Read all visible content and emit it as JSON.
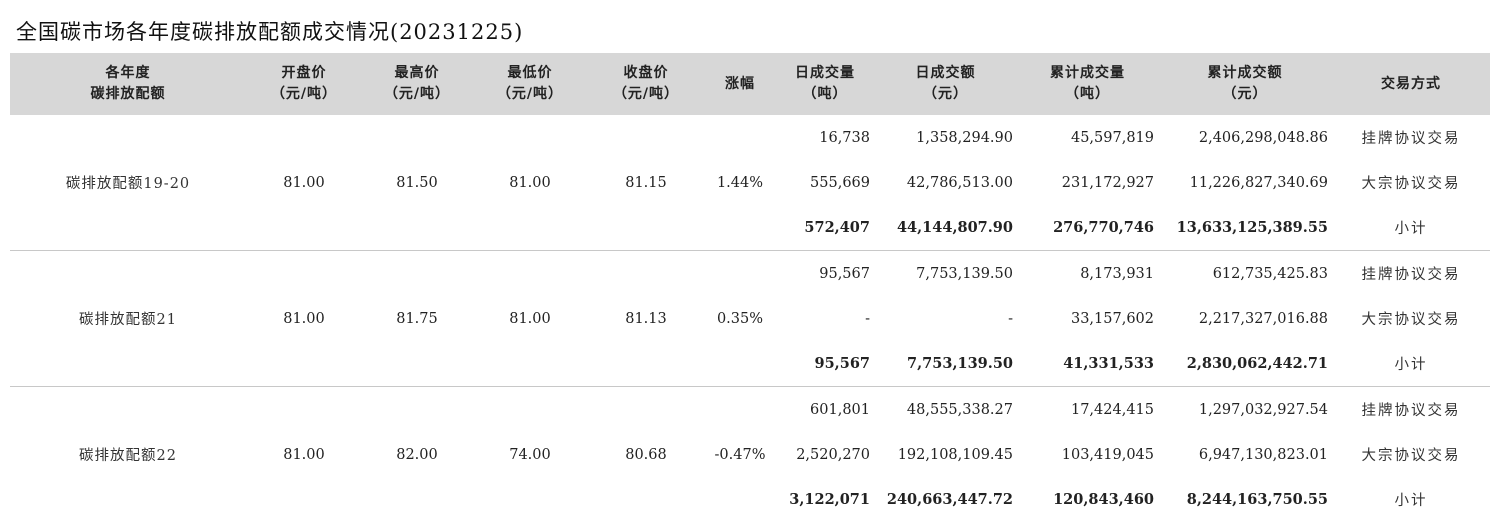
{
  "title": "全国碳市场各年度碳排放配额成交情况(20231225)",
  "table": {
    "headers": [
      {
        "line1": "各年度",
        "line2": "碳排放配额"
      },
      {
        "line1": "开盘价",
        "line2": "（元/吨）"
      },
      {
        "line1": "最高价",
        "line2": "（元/吨）"
      },
      {
        "line1": "最低价",
        "line2": "（元/吨）"
      },
      {
        "line1": "收盘价",
        "line2": "（元/吨）"
      },
      {
        "line1": "涨幅",
        "line2": ""
      },
      {
        "line1": "日成交量",
        "line2": "（吨）"
      },
      {
        "line1": "日成交额",
        "line2": "（元）"
      },
      {
        "line1": "累计成交量",
        "line2": "（吨）"
      },
      {
        "line1": "累计成交额",
        "line2": "（元）"
      },
      {
        "line1": "交易方式",
        "line2": ""
      }
    ],
    "groups": [
      {
        "name": "碳排放配额19-20",
        "open": "81.00",
        "high": "81.50",
        "low": "81.00",
        "close": "81.15",
        "change": "1.44%",
        "rows": [
          {
            "daily_volume": "16,738",
            "daily_amount": "1,358,294.90",
            "cum_volume": "45,597,819",
            "cum_amount": "2,406,298,048.86",
            "method": "挂牌协议交易"
          },
          {
            "daily_volume": "555,669",
            "daily_amount": "42,786,513.00",
            "cum_volume": "231,172,927",
            "cum_amount": "11,226,827,340.69",
            "method": "大宗协议交易"
          },
          {
            "daily_volume": "572,407",
            "daily_amount": "44,144,807.90",
            "cum_volume": "276,770,746",
            "cum_amount": "13,633,125,389.55",
            "method": "小计"
          }
        ]
      },
      {
        "name": "碳排放配额21",
        "open": "81.00",
        "high": "81.75",
        "low": "81.00",
        "close": "81.13",
        "change": "0.35%",
        "rows": [
          {
            "daily_volume": "95,567",
            "daily_amount": "7,753,139.50",
            "cum_volume": "8,173,931",
            "cum_amount": "612,735,425.83",
            "method": "挂牌协议交易"
          },
          {
            "daily_volume": "-",
            "daily_amount": "-",
            "cum_volume": "33,157,602",
            "cum_amount": "2,217,327,016.88",
            "method": "大宗协议交易"
          },
          {
            "daily_volume": "95,567",
            "daily_amount": "7,753,139.50",
            "cum_volume": "41,331,533",
            "cum_amount": "2,830,062,442.71",
            "method": "小计"
          }
        ]
      },
      {
        "name": "碳排放配额22",
        "open": "81.00",
        "high": "82.00",
        "low": "74.00",
        "close": "80.68",
        "change": "-0.47%",
        "rows": [
          {
            "daily_volume": "601,801",
            "daily_amount": "48,555,338.27",
            "cum_volume": "17,424,415",
            "cum_amount": "1,297,032,927.54",
            "method": "挂牌协议交易"
          },
          {
            "daily_volume": "2,520,270",
            "daily_amount": "192,108,109.45",
            "cum_volume": "103,419,045",
            "cum_amount": "6,947,130,823.01",
            "method": "大宗协议交易"
          },
          {
            "daily_volume": "3,122,071",
            "daily_amount": "240,663,447.72",
            "cum_volume": "120,843,460",
            "cum_amount": "8,244,163,750.55",
            "method": "小计"
          }
        ]
      }
    ]
  }
}
